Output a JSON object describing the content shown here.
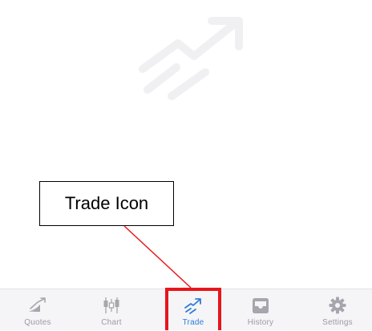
{
  "callout": {
    "text": "Trade Icon"
  },
  "colors": {
    "active": "#2f7bd9",
    "inactive": "#9a9aa2",
    "highlight": "#e8151b",
    "watermark": "#f0f0f2"
  },
  "tabbar": {
    "selected": "Trade",
    "tabs": [
      {
        "label": "Quotes",
        "icon": "quotes-icon"
      },
      {
        "label": "Chart",
        "icon": "candlestick-icon"
      },
      {
        "label": "Trade",
        "icon": "trade-icon"
      },
      {
        "label": "History",
        "icon": "inbox-icon"
      },
      {
        "label": "Settings",
        "icon": "gear-icon"
      }
    ]
  }
}
